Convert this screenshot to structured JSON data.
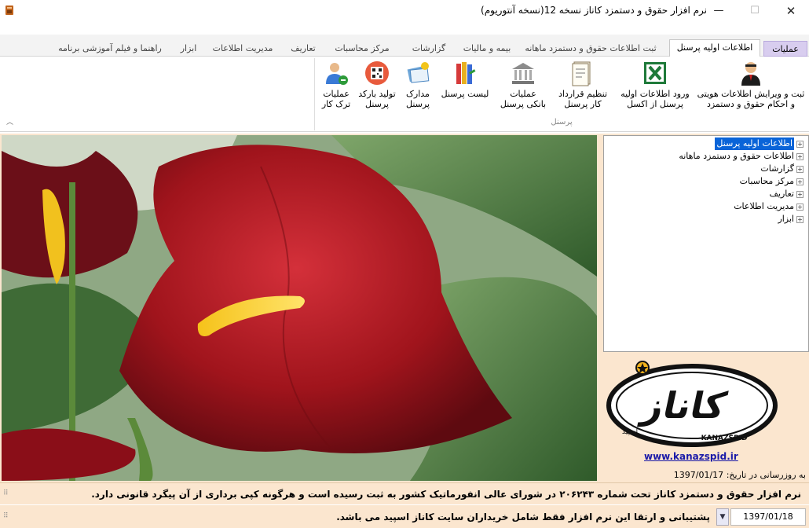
{
  "window": {
    "title": "نرم افزار حقوق و دستمزد کاناز نسخه 12(نسخه آنتوریوم)",
    "minimize": "—",
    "maximize": "☐",
    "close": "✕"
  },
  "tabs": [
    {
      "label": "عملیات",
      "type": "app"
    },
    {
      "label": "اطلاعات اولیه پرسنل",
      "type": "active"
    },
    {
      "label": "ثبت اطلاعات حقوق و دستمزد ماهانه"
    },
    {
      "label": "بیمه و مالیات"
    },
    {
      "label": "گزارشات"
    },
    {
      "label": "مرکز محاسبات"
    },
    {
      "label": "تعاریف"
    },
    {
      "label": "مدیریت اطلاعات"
    },
    {
      "label": "ابزار"
    },
    {
      "label": "راهنما و فیلم آموزشی برنامه"
    }
  ],
  "ribbon": {
    "group_label": "پرسنل",
    "buttons": [
      {
        "label": "ثبت و ویرایش اطلاعات هویتی\nو احکام حقوق و دستمزد",
        "icon": "person-agent-icon"
      },
      {
        "label": "ورود اطلاعات اولیه\nپرسنل از اکسل",
        "icon": "excel-icon"
      },
      {
        "label": "تنظیم قرارداد\nکار پرسنل",
        "icon": "contract-icon"
      },
      {
        "label": "عملیات\nبانکی پرسنل",
        "icon": "bank-icon"
      },
      {
        "label": "لیست پرسنل",
        "icon": "books-list-icon"
      },
      {
        "label": "مدارک\nپرسنل",
        "icon": "documents-icon"
      },
      {
        "label": "تولید بارکد\nپرسنل",
        "icon": "barcode-icon"
      },
      {
        "label": "عملیات\nترک کار",
        "icon": "user-leave-icon"
      }
    ]
  },
  "tree": {
    "items": [
      {
        "label": "اطلاعات اولیه پرسنل",
        "selected": true
      },
      {
        "label": "اطلاعات حقوق و دستمزد ماهانه"
      },
      {
        "label": "گزارشات"
      },
      {
        "label": "مرکز محاسبات"
      },
      {
        "label": "تعاریف"
      },
      {
        "label": "مدیریت اطلاعات"
      },
      {
        "label": "ابزار"
      }
    ],
    "expand_glyph": "+"
  },
  "logo": {
    "wordmark": "کاناز",
    "sub": "KANAZSPID",
    "tag": "اسپید"
  },
  "site_link": "www.kanazspid.ir",
  "update": {
    "label": "به روزرسانی در تاریخ:",
    "date": "1397/01/17"
  },
  "status_notice": "نرم افزار حقوق و دستمزد کاناز تحت شماره ۲۰۶۲۴۳ در شورای عالی انفورماتیک کشور به ثبت رسیده است و هرگونه کپی برداری از آن پیگرد قانونی دارد.",
  "ticker": "پشتیبانی و ارتقا این نرم افزار فقط شامل خریداران سایت کاناز اسپید می باشد.",
  "current_date": "1397/01/18",
  "colors": {
    "accent": "#0a64d8",
    "panel_bg": "#fbe6cf",
    "app_tab": "#d8cdef",
    "link": "#1a1aa8"
  }
}
